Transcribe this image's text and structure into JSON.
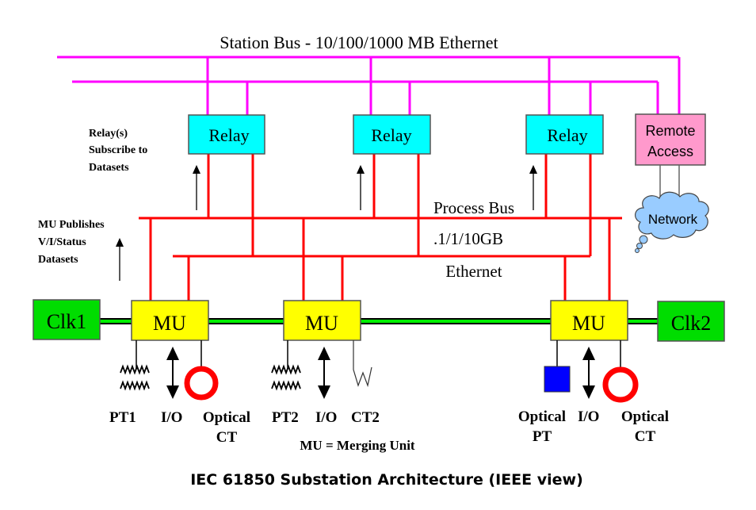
{
  "title": "IEC 61850 Substation Architecture (IEEE view)",
  "station_bus": {
    "label": "Station Bus - 10/100/1000 MB Ethernet",
    "color": "#ff00ff"
  },
  "process_bus": {
    "label_line1": "Process Bus",
    "label_line2": ".1/1/10GB",
    "label_line3": "Ethernet",
    "color": "#ff0000"
  },
  "annotations": {
    "relay_subscribe": [
      "Relay(s)",
      "Subscribe to",
      "Datasets"
    ],
    "mu_publishes": [
      "MU Publishes",
      "V/I/Status",
      "Datasets"
    ],
    "legend": "MU = Merging Unit"
  },
  "relays": [
    {
      "label": "Relay"
    },
    {
      "label": "Relay"
    },
    {
      "label": "Relay"
    }
  ],
  "remote_access": {
    "label_line1": "Remote",
    "label_line2": "Access",
    "color": "#ff99cc"
  },
  "network": {
    "label": "Network",
    "color": "#99ccff"
  },
  "clocks": [
    {
      "label": "Clk1"
    },
    {
      "label": "Clk2"
    }
  ],
  "merging_units": [
    {
      "label": "MU"
    },
    {
      "label": "MU"
    },
    {
      "label": "MU"
    }
  ],
  "devices": {
    "mu1": [
      {
        "label": "PT1",
        "icon": "transformer-coil-icon"
      },
      {
        "label": "I/O",
        "icon": "bidirectional-arrow-icon"
      },
      {
        "label_line1": "Optical",
        "label_line2": "CT",
        "icon": "optical-ct-ring-icon"
      }
    ],
    "mu2": [
      {
        "label": "PT2",
        "icon": "transformer-coil-icon"
      },
      {
        "label": "I/O",
        "icon": "bidirectional-arrow-icon"
      },
      {
        "label": "CT2",
        "icon": "ct-zigzag-icon"
      }
    ],
    "mu3": [
      {
        "label_line1": "Optical",
        "label_line2": "PT",
        "icon": "optical-pt-square-icon"
      },
      {
        "label": "I/O",
        "icon": "bidirectional-arrow-icon"
      },
      {
        "label_line1": "Optical",
        "label_line2": "CT",
        "icon": "optical-ct-ring-icon"
      }
    ]
  },
  "colors": {
    "relay_fill": "#00ffff",
    "mu_fill": "#ffff00",
    "clock_fill": "#00dd00",
    "sync_line": "#00ee00",
    "optical_ct": "#ff0000",
    "optical_pt": "#0000ff"
  }
}
